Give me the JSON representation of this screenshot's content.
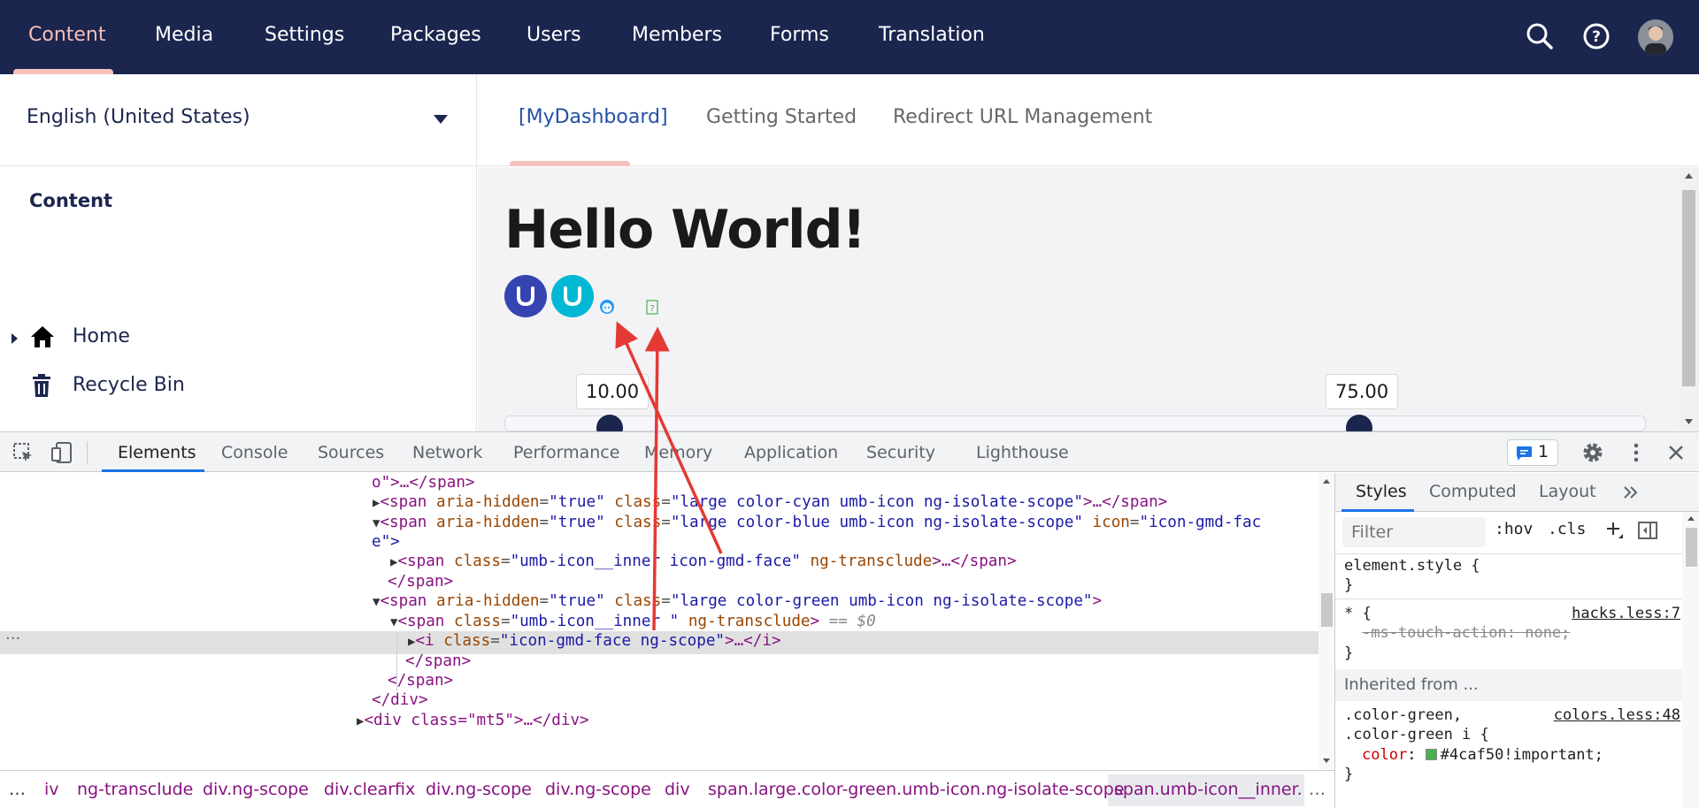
{
  "topnav": {
    "items": [
      "Content",
      "Media",
      "Settings",
      "Packages",
      "Users",
      "Members",
      "Forms",
      "Translation"
    ],
    "active_index": 0,
    "icons": [
      "search-icon",
      "help-icon",
      "user-avatar"
    ]
  },
  "sidebar": {
    "language": "English (United States)",
    "section_title": "Content",
    "tree": [
      {
        "label": "Home",
        "icon": "home-icon"
      },
      {
        "label": "Recycle Bin",
        "icon": "trash-icon"
      }
    ]
  },
  "dashboard": {
    "tabs": [
      "[MyDashboard]",
      "Getting Started",
      "Redirect URL Management"
    ],
    "active_tab": 0,
    "heading": "Hello World!",
    "icons": [
      {
        "name": "umbraco-logo-icon",
        "color": "#3544b1"
      },
      {
        "name": "umbraco-logo-icon",
        "color": "#00b8d4"
      },
      {
        "name": "face-icon",
        "color": "#2196f3"
      },
      {
        "name": "missing-glyph-icon",
        "color": "#4caf50"
      }
    ],
    "slider": {
      "min_value": "10.00",
      "max_value": "75.00"
    }
  },
  "devtools": {
    "tabs": [
      "Elements",
      "Console",
      "Sources",
      "Network",
      "Performance",
      "Memory",
      "Application",
      "Security",
      "Lighthouse"
    ],
    "active_tab": 0,
    "issues_count": "1",
    "dom_lines": {
      "l0_tail": "o\">…</span>",
      "l1_attr1": "aria-hidden",
      "l1_val1": "\"true\"",
      "l1_attr2": "class",
      "l1_val2": "\"large color-cyan umb-icon ng-isolate-scope\"",
      "l2_attr1": "aria-hidden",
      "l2_val1": "\"true\"",
      "l2_attr2": "class",
      "l2_val2": "\"large color-blue umb-icon ng-isolate-scope\"",
      "l2_attr3": "icon",
      "l2_val3": "\"icon-gmd-fac",
      "l3_tail": "e\">",
      "l4_attr1": "class",
      "l4_val1": "\"umb-icon__inner icon-gmd-face\"",
      "l4_attr2": "ng-transclude",
      "l5_close": "</span>",
      "l6_attr1": "aria-hidden",
      "l6_val1": "\"true\"",
      "l6_attr2": "class",
      "l6_val2": "\"large color-green umb-icon ng-isolate-scope\"",
      "l7_attr1": "class",
      "l7_val1": "\"umb-icon__inner \"",
      "l7_attr2": "ng-transclude",
      "l7_marker": "== $0",
      "l8_attr1": "class",
      "l8_val1": "\"icon-gmd-face ng-scope\"",
      "l9_close": "</span>",
      "l10_close": "</span>",
      "l11_close": "</div>",
      "l12_partial": "<div class=\"mt5\">…</div>"
    },
    "breadcrumbs": [
      "…",
      "iv",
      "ng-transclude",
      "div.ng-scope",
      "div.clearfix",
      "div.ng-scope",
      "div.ng-scope",
      "div",
      "span.large.color-green.umb-icon.ng-isolate-scope",
      "span.umb-icon__inner.",
      "…"
    ],
    "styles": {
      "tabs": [
        "Styles",
        "Computed",
        "Layout"
      ],
      "filter_placeholder": "Filter",
      "hov": ":hov",
      "cls": ".cls",
      "rule1_selector": "element.style {",
      "rule1_close": "}",
      "rule2_selector": "* {",
      "rule2_source": "hacks.less:7",
      "rule2_prop": "-ms-touch-action: none;",
      "rule2_close": "}",
      "inherited_label": "Inherited from ...",
      "rule3_selector1": ".color-green,",
      "rule3_source": "colors.less:48",
      "rule3_selector2": ".color-green i {",
      "rule3_prop_name": "color",
      "rule3_prop_value": "#4caf50!important;",
      "rule3_close": "}",
      "swatch_color": "#4caf50"
    }
  }
}
